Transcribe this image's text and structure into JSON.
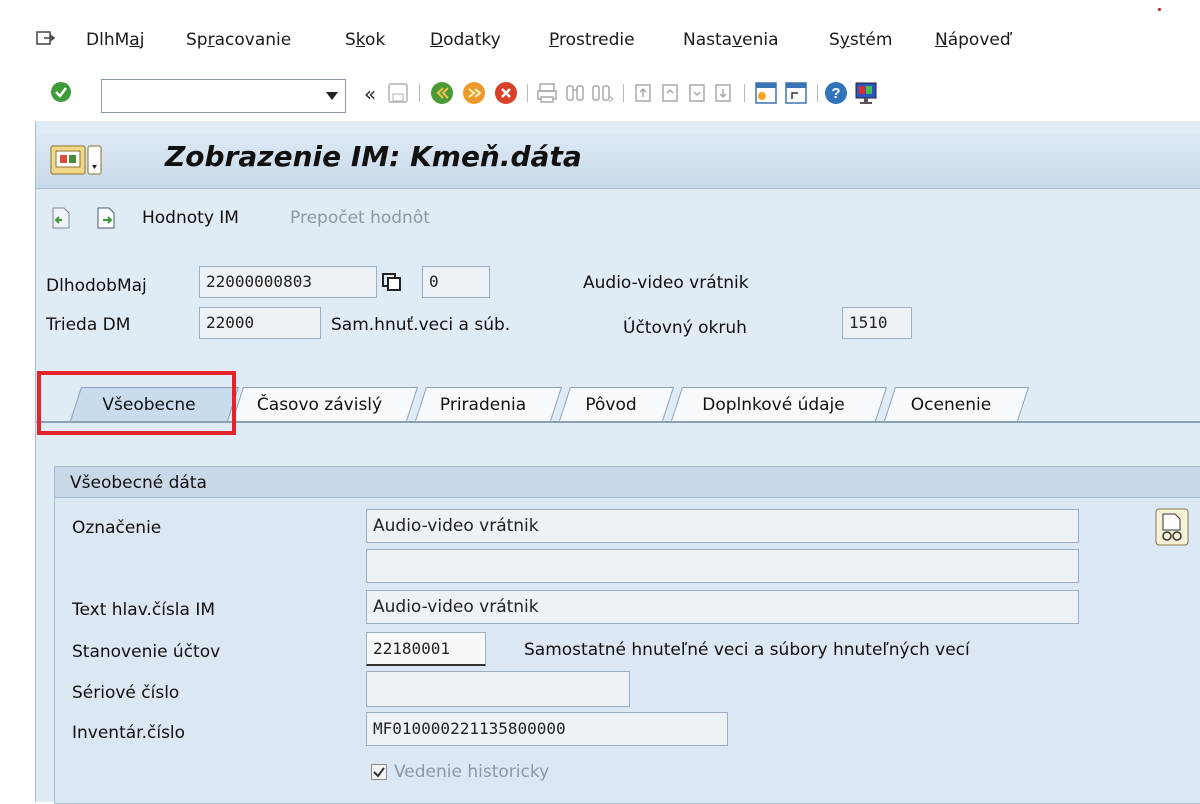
{
  "menu": {
    "items": [
      {
        "pre": "DlhM",
        "u": "a",
        "post": "j"
      },
      {
        "pre": "Sp",
        "u": "r",
        "post": "acovanie"
      },
      {
        "pre": "S",
        "u": "k",
        "post": "ok"
      },
      {
        "pre": "",
        "u": "D",
        "post": "odatky"
      },
      {
        "pre": "",
        "u": "P",
        "post": "rostredie"
      },
      {
        "pre": "Nasta",
        "u": "v",
        "post": "enia"
      },
      {
        "pre": "S",
        "u": "y",
        "post": "stém"
      },
      {
        "pre": "",
        "u": "N",
        "post": "ápoveď"
      }
    ]
  },
  "toolbar": {
    "command_field_value": "",
    "back_label": "«"
  },
  "title": "Zobrazenie IM:  Kmeň.dáta",
  "app_toolbar": {
    "values_button": "Hodnoty IM",
    "recalc_button": "Prepočet hodnôt"
  },
  "header": {
    "asset_label": "DlhodobMaj",
    "asset_number": "22000000803",
    "sub_number": "0",
    "asset_description": "Audio-video vrátnik",
    "class_label": "Trieda DM",
    "class_value": "22000",
    "class_description": "Sam.hnuť.veci a súb.",
    "company_code_label": "Účtovný okruh",
    "company_code_value": "1510"
  },
  "tabs": [
    "Všeobecne",
    "Časovo závislý",
    "Priradenia",
    "Pôvod",
    "Doplnkové údaje",
    "Ocenenie"
  ],
  "general": {
    "group_title": "Všeobecné dáta",
    "designation_label": "Označenie",
    "designation_value": "Audio-video vrátnik",
    "designation_value2": "",
    "main_text_label": "Text hlav.čísla IM",
    "main_text_value": "Audio-video vrátnik",
    "acct_det_label": "Stanovenie účtov",
    "acct_det_value": "22180001",
    "acct_det_description": "Samostatné hnuteľné veci a súbory hnuteľných vecí",
    "serial_label": "Sériové číslo",
    "serial_value": "",
    "inventory_label": "Inventár.číslo",
    "inventory_value": "MF010000221135800000",
    "history_label": "Vedenie historicky",
    "history_checked": true
  }
}
